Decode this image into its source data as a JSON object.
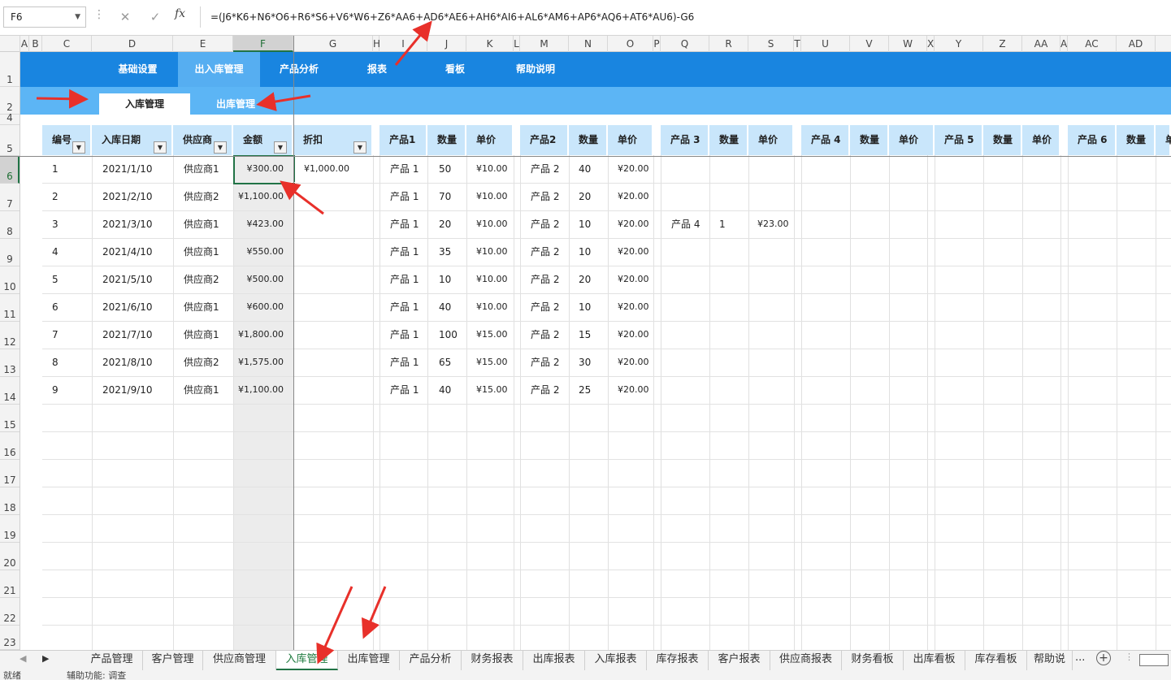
{
  "formula_bar": {
    "name_box": "F6",
    "cancel_icon": "✕",
    "enter_icon": "✓",
    "fx_label": "fx",
    "formula": "=(J6*K6+N6*O6+R6*S6+V6*W6+Z6*AA6+AD6*AE6+AH6*AI6+AL6*AM6+AP6*AQ6+AT6*AU6)-G6"
  },
  "columns": [
    {
      "label": "A"
    },
    {
      "label": "B"
    },
    {
      "label": "C"
    },
    {
      "label": "D"
    },
    {
      "label": "E"
    },
    {
      "label": "F"
    },
    {
      "label": "G"
    },
    {
      "label": "H"
    },
    {
      "label": "I"
    },
    {
      "label": "J"
    },
    {
      "label": "K"
    },
    {
      "label": "L"
    },
    {
      "label": "M"
    },
    {
      "label": "N"
    },
    {
      "label": "O"
    },
    {
      "label": "P"
    },
    {
      "label": "Q"
    },
    {
      "label": "R"
    },
    {
      "label": "S"
    },
    {
      "label": "T"
    },
    {
      "label": "U"
    },
    {
      "label": "V"
    },
    {
      "label": "W"
    },
    {
      "label": "X"
    },
    {
      "label": "Y"
    },
    {
      "label": "Z"
    },
    {
      "label": "AA"
    },
    {
      "label": "A"
    },
    {
      "label": "AC"
    },
    {
      "label": "AD"
    }
  ],
  "row_numbers": [
    "1",
    "2",
    "4",
    "5",
    "6",
    "7",
    "8",
    "9",
    "10",
    "11",
    "12",
    "13",
    "14",
    "15",
    "16",
    "17",
    "18",
    "19",
    "20",
    "21",
    "22",
    "23"
  ],
  "nav": {
    "items": [
      "基础设置",
      "出入库管理",
      "产品分析",
      "报表",
      "看板",
      "帮助说明"
    ],
    "active": "出入库管理"
  },
  "subnav": {
    "items": [
      "入库管理",
      "出库管理"
    ],
    "active": "入库管理"
  },
  "table": {
    "headers": {
      "id": "编号",
      "date": "入库日期",
      "supplier": "供应商",
      "amount": "金额",
      "discount": "折扣",
      "p1": "产品1",
      "q1": "数量",
      "u1": "单价",
      "p2": "产品2",
      "q2": "数量",
      "u2": "单价",
      "p3": "产品 3",
      "q3": "数量",
      "u3": "单价",
      "p4": "产品 4",
      "q4": "数量",
      "u4": "单价",
      "p5": "产品 5",
      "q5": "数量",
      "u5": "单价",
      "p6": "产品 6",
      "q6": "数量",
      "u6": "单"
    },
    "rows": [
      {
        "id": "1",
        "date": "2021/1/10",
        "supplier": "供应商1",
        "amount": "¥300.00",
        "discount": "¥1,000.00",
        "p1": "产品 1",
        "q1": "50",
        "u1": "¥10.00",
        "p2": "产品 2",
        "q2": "40",
        "u2": "¥20.00",
        "p3": "",
        "q3": "",
        "u3": ""
      },
      {
        "id": "2",
        "date": "2021/2/10",
        "supplier": "供应商2",
        "amount": "¥1,100.00",
        "discount": "",
        "p1": "产品 1",
        "q1": "70",
        "u1": "¥10.00",
        "p2": "产品 2",
        "q2": "20",
        "u2": "¥20.00",
        "p3": "",
        "q3": "",
        "u3": ""
      },
      {
        "id": "3",
        "date": "2021/3/10",
        "supplier": "供应商1",
        "amount": "¥423.00",
        "discount": "",
        "p1": "产品 1",
        "q1": "20",
        "u1": "¥10.00",
        "p2": "产品 2",
        "q2": "10",
        "u2": "¥20.00",
        "p3": "产品 4",
        "q3": "1",
        "u3": "¥23.00"
      },
      {
        "id": "4",
        "date": "2021/4/10",
        "supplier": "供应商1",
        "amount": "¥550.00",
        "discount": "",
        "p1": "产品 1",
        "q1": "35",
        "u1": "¥10.00",
        "p2": "产品 2",
        "q2": "10",
        "u2": "¥20.00",
        "p3": "",
        "q3": "",
        "u3": ""
      },
      {
        "id": "5",
        "date": "2021/5/10",
        "supplier": "供应商2",
        "amount": "¥500.00",
        "discount": "",
        "p1": "产品 1",
        "q1": "10",
        "u1": "¥10.00",
        "p2": "产品 2",
        "q2": "20",
        "u2": "¥20.00",
        "p3": "",
        "q3": "",
        "u3": ""
      },
      {
        "id": "6",
        "date": "2021/6/10",
        "supplier": "供应商1",
        "amount": "¥600.00",
        "discount": "",
        "p1": "产品 1",
        "q1": "40",
        "u1": "¥10.00",
        "p2": "产品 2",
        "q2": "10",
        "u2": "¥20.00",
        "p3": "",
        "q3": "",
        "u3": ""
      },
      {
        "id": "7",
        "date": "2021/7/10",
        "supplier": "供应商1",
        "amount": "¥1,800.00",
        "discount": "",
        "p1": "产品 1",
        "q1": "100",
        "u1": "¥15.00",
        "p2": "产品 2",
        "q2": "15",
        "u2": "¥20.00",
        "p3": "",
        "q3": "",
        "u3": ""
      },
      {
        "id": "8",
        "date": "2021/8/10",
        "supplier": "供应商2",
        "amount": "¥1,575.00",
        "discount": "",
        "p1": "产品 1",
        "q1": "65",
        "u1": "¥15.00",
        "p2": "产品 2",
        "q2": "30",
        "u2": "¥20.00",
        "p3": "",
        "q3": "",
        "u3": ""
      },
      {
        "id": "9",
        "date": "2021/9/10",
        "supplier": "供应商1",
        "amount": "¥1,100.00",
        "discount": "",
        "p1": "产品 1",
        "q1": "40",
        "u1": "¥15.00",
        "p2": "产品 2",
        "q2": "25",
        "u2": "¥20.00",
        "p3": "",
        "q3": "",
        "u3": ""
      }
    ]
  },
  "sheet_tabs": [
    "产品管理",
    "客户管理",
    "供应商管理",
    "入库管理",
    "出库管理",
    "产品分析",
    "财务报表",
    "出库报表",
    "入库报表",
    "库存报表",
    "客户报表",
    "供应商报表",
    "财务看板",
    "出库看板",
    "库存看板",
    "帮助说"
  ],
  "active_sheet": "入库管理",
  "tab_more": "...",
  "add_sheet_icon": "+",
  "status": {
    "ready": "就绪",
    "accessibility": "辅助功能: 调查"
  },
  "colors": {
    "nav_bg": "#1985e0",
    "nav_active": "#56aef1",
    "subnav_bg": "#5cb5f5",
    "header_bg": "#c9e6fb",
    "excel_green": "#217346",
    "arrow": "#e8302a"
  }
}
